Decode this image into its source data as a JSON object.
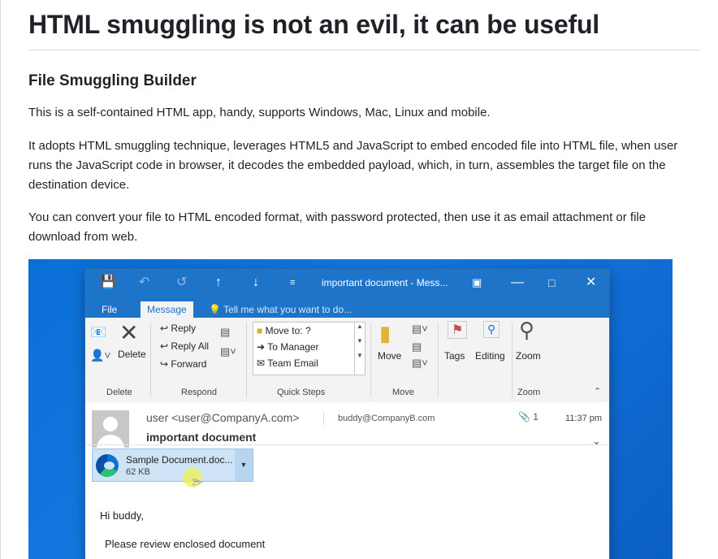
{
  "article": {
    "heading": "HTML smuggling is not an evil, it can be useful",
    "subheading": "File Smuggling Builder",
    "paragraphs": [
      "This is a self-contained HTML app, handy, supports Windows, Mac, Linux and mobile.",
      "It adopts HTML smuggling technique, leverages HTML5 and JavaScript to embed encoded file into HTML file, when user runs the JavaScript code in browser, it decodes the embedded payload, which, in turn, assembles the target file on the destination device.",
      "You can convert your file to HTML encoded format, with password protected, then use it as email attachment or file download from web."
    ]
  },
  "outlook": {
    "window_title": "important document - Mess...",
    "titlebar_icons": [
      "save-icon",
      "undo-icon",
      "redo-icon",
      "up-arrow-icon",
      "down-arrow-icon",
      "customize-icon",
      "ribbon-display-icon",
      "minimize-icon",
      "maximize-icon",
      "close-icon"
    ],
    "tabs": [
      "File",
      "Message"
    ],
    "tell_me": "Tell me what you want to do...",
    "ribbon": {
      "delete_label": "Delete",
      "reply": "Reply",
      "reply_all": "Reply All",
      "forward": "Forward",
      "quick_steps": [
        "Move to: ?",
        "To Manager",
        "Team Email"
      ],
      "move": "Move",
      "tags": "Tags",
      "editing": "Editing",
      "zoom": "Zoom",
      "groups": [
        "Delete",
        "Respond",
        "Quick Steps",
        "Move",
        "Zoom"
      ]
    },
    "message": {
      "from": "user <user@CompanyA.com>",
      "to": "buddy@CompanyB.com",
      "attachment_count": "1",
      "time": "11:37 pm",
      "subject": "important document",
      "attachment_name": "Sample Document.doc...",
      "attachment_size": "62 KB",
      "greeting": "Hi buddy,",
      "body": "Please review enclosed document"
    }
  }
}
